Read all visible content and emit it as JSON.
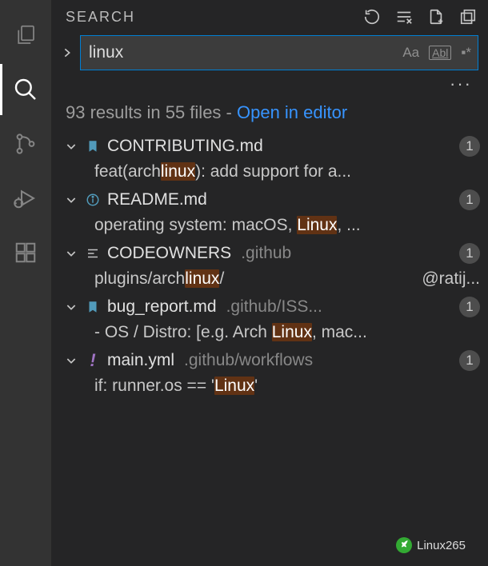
{
  "activity": {
    "items": [
      "explorer",
      "search",
      "scm",
      "debug",
      "extensions"
    ],
    "active": 1
  },
  "panel": {
    "title": "SEARCH"
  },
  "search": {
    "query": "linux",
    "toggles": {
      "case": "Aa",
      "word": "Abl",
      "regex": "▪*"
    }
  },
  "summary": {
    "text_a": "93 results in 55 files - ",
    "link": "Open in editor"
  },
  "results": [
    {
      "name": "CONTRIBUTING.md",
      "path": "",
      "count": "1",
      "icon": "bookmark-blue",
      "match": {
        "pre": "feat(arch",
        "hi": "linux",
        "post": "): add support for a..."
      }
    },
    {
      "name": "README.md",
      "path": "",
      "count": "1",
      "icon": "info",
      "match": {
        "pre": "operating system: macOS, ",
        "hi": "Linux",
        "post": ", ..."
      }
    },
    {
      "name": "CODEOWNERS",
      "path": ".github",
      "count": "1",
      "icon": "lines",
      "match": {
        "pre": "plugins/arch",
        "hi": "linux",
        "post": "/",
        "right": "@ratij..."
      }
    },
    {
      "name": "bug_report.md",
      "path": ".github/ISS...",
      "count": "1",
      "icon": "bookmark-blue",
      "match": {
        "pre": "- OS / Distro: [e.g. Arch ",
        "hi": "Linux",
        "post": ", mac..."
      }
    },
    {
      "name": "main.yml",
      "path": ".github/workflows",
      "count": "1",
      "icon": "exclaim",
      "match": {
        "pre": "if: runner.os == '",
        "hi": "Linux",
        "post": "'"
      }
    }
  ],
  "watermark": "Linux265"
}
